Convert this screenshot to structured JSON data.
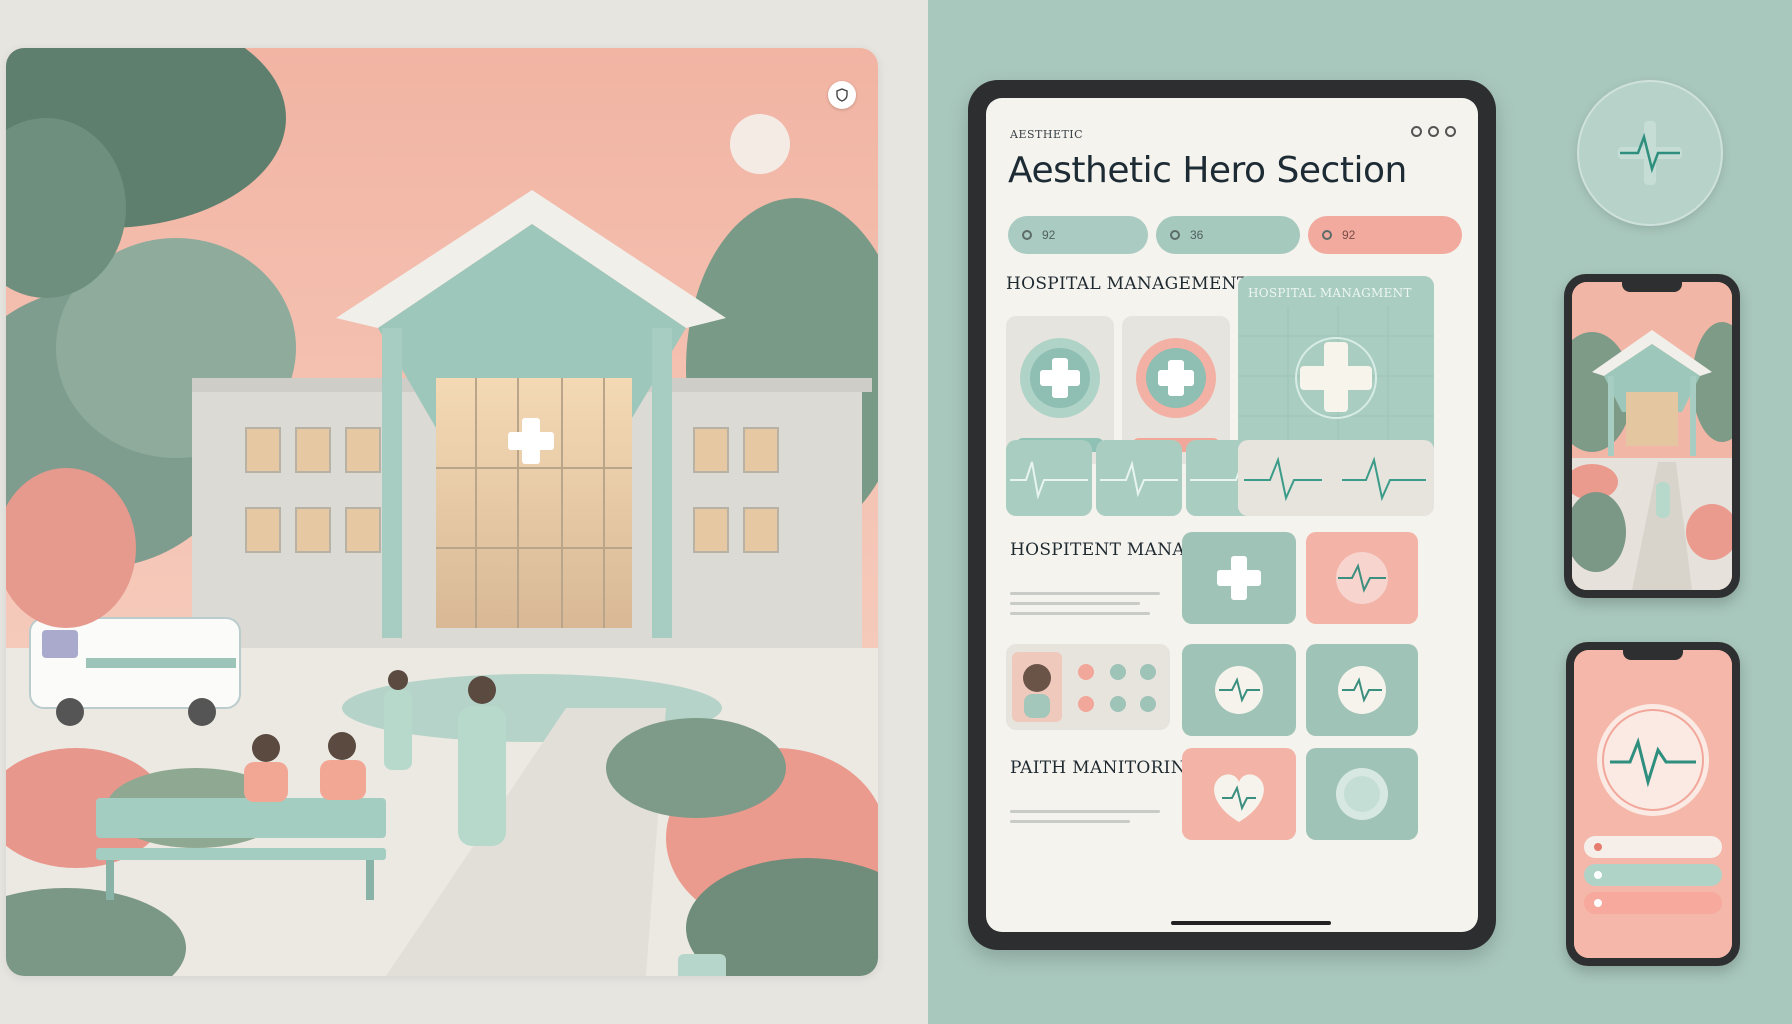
{
  "tablet": {
    "kicker": "AESTHETIC",
    "title": "Aesthetic Hero Section",
    "pills": [
      "92",
      "36",
      "92"
    ],
    "section_hospital_management": "HOSPITAL MANAGEMENT",
    "card_hospital_management": "HOSPITAL MANAGMENT",
    "section_hospital_management_2": "HOSPITENT MANAGEMENT",
    "section_patient_monitoring": "PAITH MANITORING"
  },
  "colors": {
    "accent_mint": "#9cc4b8",
    "accent_teal": "#2f8f7e",
    "accent_coral": "#f2aa9f",
    "background_right": "#a9c8bd"
  },
  "icons": [
    "cross-icon",
    "heartbeat-icon",
    "heart-icon",
    "shield-icon"
  ]
}
